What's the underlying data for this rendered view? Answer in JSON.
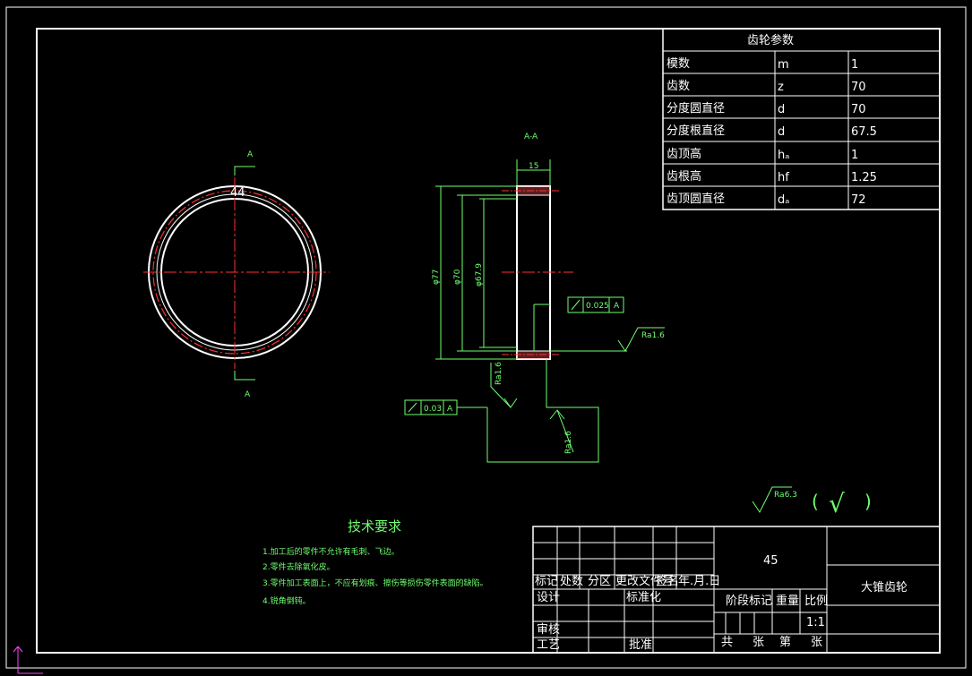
{
  "params_table": {
    "title": "齿轮参数",
    "rows": [
      {
        "name": "模数",
        "symbol": "m",
        "value": "1"
      },
      {
        "name": "齿数",
        "symbol": "z",
        "value": "70"
      },
      {
        "name": "分度圆直径",
        "symbol": "d",
        "value": "70"
      },
      {
        "name": "分度根直径",
        "symbol": "d",
        "value": "67.5"
      },
      {
        "name": "齿顶高",
        "symbol": "hₐ",
        "value": "1"
      },
      {
        "name": "齿根高",
        "symbol": "hf",
        "value": "1.25"
      },
      {
        "name": "齿顶圆直径",
        "symbol": "dₐ",
        "value": "72"
      }
    ]
  },
  "front_view": {
    "section_label": "A",
    "hub_label": "44"
  },
  "section_view": {
    "title": "A-A",
    "width_dim": "15",
    "dim_outer": "φ77",
    "dim_pitch": "φ70",
    "dim_root": "φ67.9",
    "tol_runout": {
      "value": "0.025",
      "datum": "A"
    },
    "tol_face": {
      "value": "0.03",
      "datum": "A"
    },
    "ra_outer": "Ra1.6",
    "ra_bore": "Ra1.6",
    "ra_face": "Ra1.6"
  },
  "surface_note": {
    "ra": "Ra6.3",
    "paren_open": "(",
    "check": "√",
    "paren_close": ")"
  },
  "tech_req": {
    "title": "技术要求",
    "items": [
      "1.加工后的零件不允许有毛刺、飞边。",
      "2.零件去除氧化皮。",
      "3.零件加工表面上，不应有划痕、擦伤等损伤零件表面的缺陷。",
      "4.锐角倒钝。"
    ]
  },
  "title_block": {
    "material": "45",
    "part_name": "大锥齿轮",
    "header": [
      "标记",
      "处数",
      "分区",
      "更改文件号",
      "签名",
      "年.月.日"
    ],
    "design": "设计",
    "standardize": "标准化",
    "stage_mark": "阶段标记",
    "weight": "重量",
    "scale": "比例",
    "review": "审核",
    "process": "工艺",
    "approve": "批准",
    "total": "共",
    "sheets": "张",
    "page": "第",
    "sheet2": "张",
    "scale_value": "1:1"
  },
  "colors": {
    "frame": "#ffffff",
    "dim": "#6fff6f",
    "center": "#ff3030",
    "geometry": "#ffffff"
  }
}
